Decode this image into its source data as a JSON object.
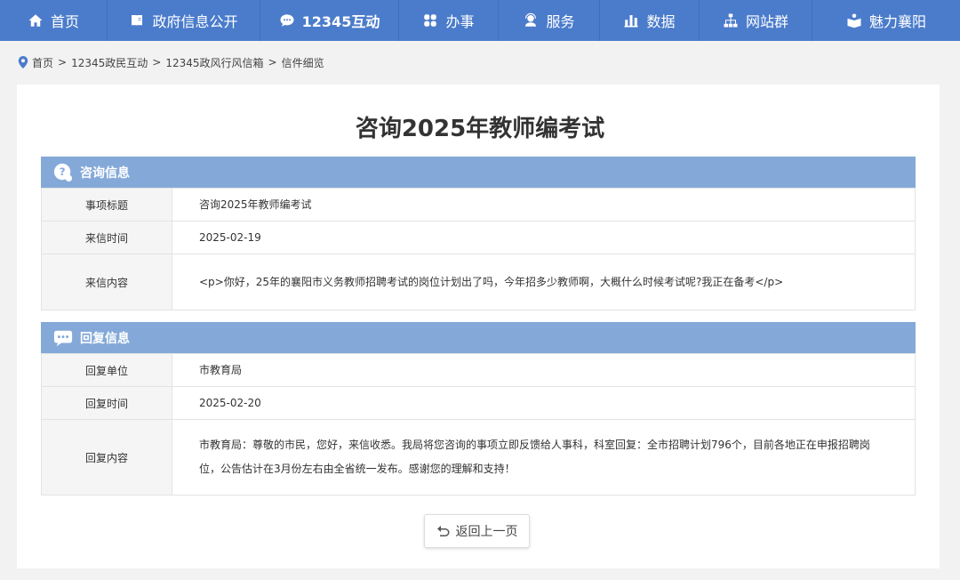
{
  "nav": [
    {
      "label": "首页",
      "icon": "home-icon"
    },
    {
      "label": "政府信息公开",
      "icon": "book-icon"
    },
    {
      "label": "12345互动",
      "icon": "chat-icon"
    },
    {
      "label": "办事",
      "icon": "grid-icon"
    },
    {
      "label": "服务",
      "icon": "service-person-icon"
    },
    {
      "label": "数据",
      "icon": "bar-chart-icon"
    },
    {
      "label": "网站群",
      "icon": "sitemap-icon"
    },
    {
      "label": "魅力襄阳",
      "icon": "open-book-icon"
    }
  ],
  "breadcrumb": [
    "首页",
    "12345政民互动",
    "12345政风行风信箱",
    "信件细览"
  ],
  "breadcrumb_separator": ">",
  "page_title": "咨询2025年教师编考试",
  "inquiry": {
    "heading": "咨询信息",
    "rows": [
      {
        "label": "事项标题",
        "value": "咨询2025年教师编考试"
      },
      {
        "label": "来信时间",
        "value": "2025-02-19"
      },
      {
        "label": "来信内容",
        "value": "<p>你好，25年的襄阳市义务教师招聘考试的岗位计划出了吗，今年招多少教师啊，大概什么时候考试呢?我正在备考</p>"
      }
    ]
  },
  "reply": {
    "heading": "回复信息",
    "rows": [
      {
        "label": "回复单位",
        "value": "市教育局"
      },
      {
        "label": "回复时间",
        "value": "2025-02-20"
      },
      {
        "label": "回复内容",
        "value": "市教育局：尊敬的市民，您好，来信收悉。我局将您咨询的事项立即反馈给人事科，科室回复：全市招聘计划796个，目前各地正在申报招聘岗位，公告估计在3月份左右由全省统一发布。感谢您的理解和支持！"
      }
    ]
  },
  "back_button": "返回上一页",
  "colors": {
    "nav_bg": "#4b7ccb",
    "section_head_bg": "#84a9d9",
    "page_bg": "#f2f2f2"
  }
}
